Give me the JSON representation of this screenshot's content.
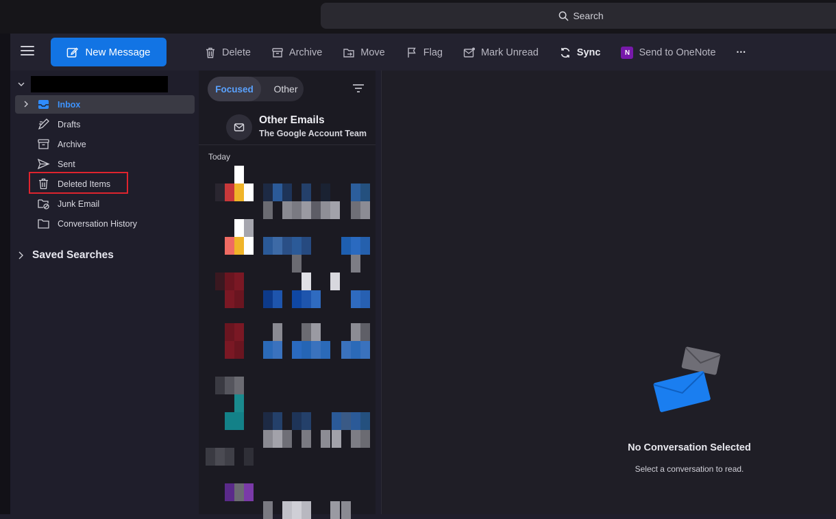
{
  "search": {
    "placeholder": "Search"
  },
  "toolbar": {
    "new_message": "New Message",
    "actions": [
      {
        "label": "Delete",
        "icon": "trash-icon"
      },
      {
        "label": "Archive",
        "icon": "archive-icon"
      },
      {
        "label": "Move",
        "icon": "move-folder-icon"
      },
      {
        "label": "Flag",
        "icon": "flag-icon"
      },
      {
        "label": "Mark Unread",
        "icon": "mark-unread-icon"
      },
      {
        "label": "Sync",
        "icon": "sync-icon"
      },
      {
        "label": "Send to OneNote",
        "icon": "onenote-icon"
      }
    ],
    "more": "···"
  },
  "sidebar": {
    "folders": [
      {
        "label": "Inbox",
        "icon": "inbox-icon",
        "active": true
      },
      {
        "label": "Drafts",
        "icon": "drafts-icon"
      },
      {
        "label": "Archive",
        "icon": "archive-icon"
      },
      {
        "label": "Sent",
        "icon": "sent-icon"
      },
      {
        "label": "Deleted Items",
        "icon": "trash-icon",
        "highlighted": true
      },
      {
        "label": "Junk Email",
        "icon": "junk-icon"
      },
      {
        "label": "Conversation History",
        "icon": "folder-icon"
      }
    ],
    "saved_searches": "Saved Searches"
  },
  "message_list": {
    "tabs": [
      "Focused",
      "Other"
    ],
    "other_emails": {
      "title": "Other Emails",
      "sender": "The Google Account Team"
    },
    "group_header": "Today"
  },
  "reading_pane": {
    "title": "No Conversation Selected",
    "subtitle": "Select a conversation to read."
  },
  "colors": {
    "accent": "#1274e4",
    "highlight_box": "#e0242e",
    "onenote": "#7719aa"
  }
}
